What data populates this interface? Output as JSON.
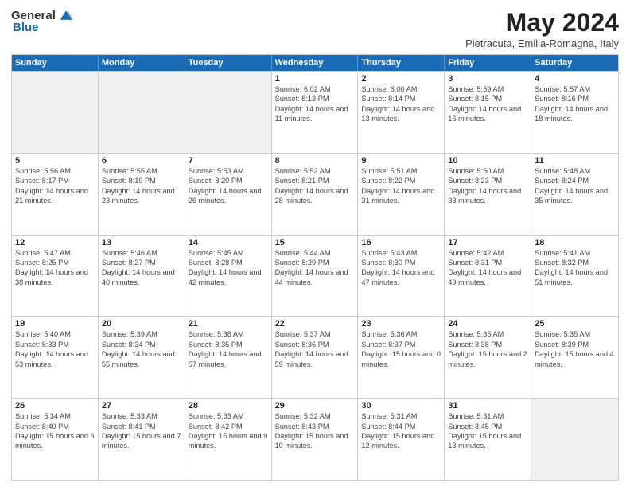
{
  "logo": {
    "general": "General",
    "blue": "Blue"
  },
  "title": "May 2024",
  "location": "Pietracuta, Emilia-Romagna, Italy",
  "weekdays": [
    "Sunday",
    "Monday",
    "Tuesday",
    "Wednesday",
    "Thursday",
    "Friday",
    "Saturday"
  ],
  "rows": [
    [
      {
        "day": "",
        "sunrise": "",
        "sunset": "",
        "daylight": "",
        "shaded": true
      },
      {
        "day": "",
        "sunrise": "",
        "sunset": "",
        "daylight": "",
        "shaded": true
      },
      {
        "day": "",
        "sunrise": "",
        "sunset": "",
        "daylight": "",
        "shaded": true
      },
      {
        "day": "1",
        "sunrise": "Sunrise: 6:02 AM",
        "sunset": "Sunset: 8:13 PM",
        "daylight": "Daylight: 14 hours and 11 minutes.",
        "shaded": false
      },
      {
        "day": "2",
        "sunrise": "Sunrise: 6:00 AM",
        "sunset": "Sunset: 8:14 PM",
        "daylight": "Daylight: 14 hours and 13 minutes.",
        "shaded": false
      },
      {
        "day": "3",
        "sunrise": "Sunrise: 5:59 AM",
        "sunset": "Sunset: 8:15 PM",
        "daylight": "Daylight: 14 hours and 16 minutes.",
        "shaded": false
      },
      {
        "day": "4",
        "sunrise": "Sunrise: 5:57 AM",
        "sunset": "Sunset: 8:16 PM",
        "daylight": "Daylight: 14 hours and 18 minutes.",
        "shaded": false
      }
    ],
    [
      {
        "day": "5",
        "sunrise": "Sunrise: 5:56 AM",
        "sunset": "Sunset: 8:17 PM",
        "daylight": "Daylight: 14 hours and 21 minutes.",
        "shaded": false
      },
      {
        "day": "6",
        "sunrise": "Sunrise: 5:55 AM",
        "sunset": "Sunset: 8:19 PM",
        "daylight": "Daylight: 14 hours and 23 minutes.",
        "shaded": false
      },
      {
        "day": "7",
        "sunrise": "Sunrise: 5:53 AM",
        "sunset": "Sunset: 8:20 PM",
        "daylight": "Daylight: 14 hours and 26 minutes.",
        "shaded": false
      },
      {
        "day": "8",
        "sunrise": "Sunrise: 5:52 AM",
        "sunset": "Sunset: 8:21 PM",
        "daylight": "Daylight: 14 hours and 28 minutes.",
        "shaded": false
      },
      {
        "day": "9",
        "sunrise": "Sunrise: 5:51 AM",
        "sunset": "Sunset: 8:22 PM",
        "daylight": "Daylight: 14 hours and 31 minutes.",
        "shaded": false
      },
      {
        "day": "10",
        "sunrise": "Sunrise: 5:50 AM",
        "sunset": "Sunset: 8:23 PM",
        "daylight": "Daylight: 14 hours and 33 minutes.",
        "shaded": false
      },
      {
        "day": "11",
        "sunrise": "Sunrise: 5:48 AM",
        "sunset": "Sunset: 8:24 PM",
        "daylight": "Daylight: 14 hours and 35 minutes.",
        "shaded": false
      }
    ],
    [
      {
        "day": "12",
        "sunrise": "Sunrise: 5:47 AM",
        "sunset": "Sunset: 8:25 PM",
        "daylight": "Daylight: 14 hours and 38 minutes.",
        "shaded": false
      },
      {
        "day": "13",
        "sunrise": "Sunrise: 5:46 AM",
        "sunset": "Sunset: 8:27 PM",
        "daylight": "Daylight: 14 hours and 40 minutes.",
        "shaded": false
      },
      {
        "day": "14",
        "sunrise": "Sunrise: 5:45 AM",
        "sunset": "Sunset: 8:28 PM",
        "daylight": "Daylight: 14 hours and 42 minutes.",
        "shaded": false
      },
      {
        "day": "15",
        "sunrise": "Sunrise: 5:44 AM",
        "sunset": "Sunset: 8:29 PM",
        "daylight": "Daylight: 14 hours and 44 minutes.",
        "shaded": false
      },
      {
        "day": "16",
        "sunrise": "Sunrise: 5:43 AM",
        "sunset": "Sunset: 8:30 PM",
        "daylight": "Daylight: 14 hours and 47 minutes.",
        "shaded": false
      },
      {
        "day": "17",
        "sunrise": "Sunrise: 5:42 AM",
        "sunset": "Sunset: 8:31 PM",
        "daylight": "Daylight: 14 hours and 49 minutes.",
        "shaded": false
      },
      {
        "day": "18",
        "sunrise": "Sunrise: 5:41 AM",
        "sunset": "Sunset: 8:32 PM",
        "daylight": "Daylight: 14 hours and 51 minutes.",
        "shaded": false
      }
    ],
    [
      {
        "day": "19",
        "sunrise": "Sunrise: 5:40 AM",
        "sunset": "Sunset: 8:33 PM",
        "daylight": "Daylight: 14 hours and 53 minutes.",
        "shaded": false
      },
      {
        "day": "20",
        "sunrise": "Sunrise: 5:39 AM",
        "sunset": "Sunset: 8:34 PM",
        "daylight": "Daylight: 14 hours and 55 minutes.",
        "shaded": false
      },
      {
        "day": "21",
        "sunrise": "Sunrise: 5:38 AM",
        "sunset": "Sunset: 8:35 PM",
        "daylight": "Daylight: 14 hours and 57 minutes.",
        "shaded": false
      },
      {
        "day": "22",
        "sunrise": "Sunrise: 5:37 AM",
        "sunset": "Sunset: 8:36 PM",
        "daylight": "Daylight: 14 hours and 59 minutes.",
        "shaded": false
      },
      {
        "day": "23",
        "sunrise": "Sunrise: 5:36 AM",
        "sunset": "Sunset: 8:37 PM",
        "daylight": "Daylight: 15 hours and 0 minutes.",
        "shaded": false
      },
      {
        "day": "24",
        "sunrise": "Sunrise: 5:35 AM",
        "sunset": "Sunset: 8:38 PM",
        "daylight": "Daylight: 15 hours and 2 minutes.",
        "shaded": false
      },
      {
        "day": "25",
        "sunrise": "Sunrise: 5:35 AM",
        "sunset": "Sunset: 8:39 PM",
        "daylight": "Daylight: 15 hours and 4 minutes.",
        "shaded": false
      }
    ],
    [
      {
        "day": "26",
        "sunrise": "Sunrise: 5:34 AM",
        "sunset": "Sunset: 8:40 PM",
        "daylight": "Daylight: 15 hours and 6 minutes.",
        "shaded": false
      },
      {
        "day": "27",
        "sunrise": "Sunrise: 5:33 AM",
        "sunset": "Sunset: 8:41 PM",
        "daylight": "Daylight: 15 hours and 7 minutes.",
        "shaded": false
      },
      {
        "day": "28",
        "sunrise": "Sunrise: 5:33 AM",
        "sunset": "Sunset: 8:42 PM",
        "daylight": "Daylight: 15 hours and 9 minutes.",
        "shaded": false
      },
      {
        "day": "29",
        "sunrise": "Sunrise: 5:32 AM",
        "sunset": "Sunset: 8:43 PM",
        "daylight": "Daylight: 15 hours and 10 minutes.",
        "shaded": false
      },
      {
        "day": "30",
        "sunrise": "Sunrise: 5:31 AM",
        "sunset": "Sunset: 8:44 PM",
        "daylight": "Daylight: 15 hours and 12 minutes.",
        "shaded": false
      },
      {
        "day": "31",
        "sunrise": "Sunrise: 5:31 AM",
        "sunset": "Sunset: 8:45 PM",
        "daylight": "Daylight: 15 hours and 13 minutes.",
        "shaded": false
      },
      {
        "day": "",
        "sunrise": "",
        "sunset": "",
        "daylight": "",
        "shaded": true
      }
    ]
  ]
}
